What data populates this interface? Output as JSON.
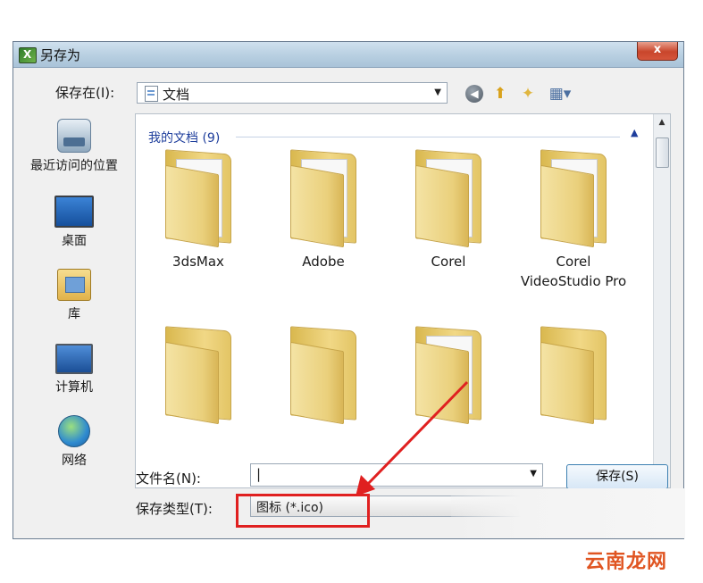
{
  "window": {
    "title": "另存为",
    "close_label": "x"
  },
  "toolbar": {
    "save_in_label": "保存在(I):",
    "save_in_value": "文档",
    "icons": [
      "back-icon",
      "up-folder-icon",
      "new-folder-icon",
      "views-menu-icon"
    ]
  },
  "places": [
    {
      "label": "最近访问的位置",
      "icon": "recent-places-icon"
    },
    {
      "label": "桌面",
      "icon": "desktop-icon"
    },
    {
      "label": "库",
      "icon": "library-icon"
    },
    {
      "label": "计算机",
      "icon": "computer-icon"
    },
    {
      "label": "网络",
      "icon": "network-icon"
    }
  ],
  "file_area": {
    "group_header": "我的文档 (9)",
    "folders": [
      {
        "label": "3dsMax"
      },
      {
        "label": "Adobe"
      },
      {
        "label": "Corel"
      },
      {
        "label": "Corel VideoStudio Pro"
      }
    ]
  },
  "filename": {
    "label": "文件名(N):",
    "value": ""
  },
  "filetype": {
    "label": "保存类型(T):",
    "value": "图标 (*.ico)"
  },
  "buttons": {
    "save": "保存(S)"
  },
  "annotation": {
    "highlight_color": "#e02020"
  },
  "watermark": "云南龙网"
}
